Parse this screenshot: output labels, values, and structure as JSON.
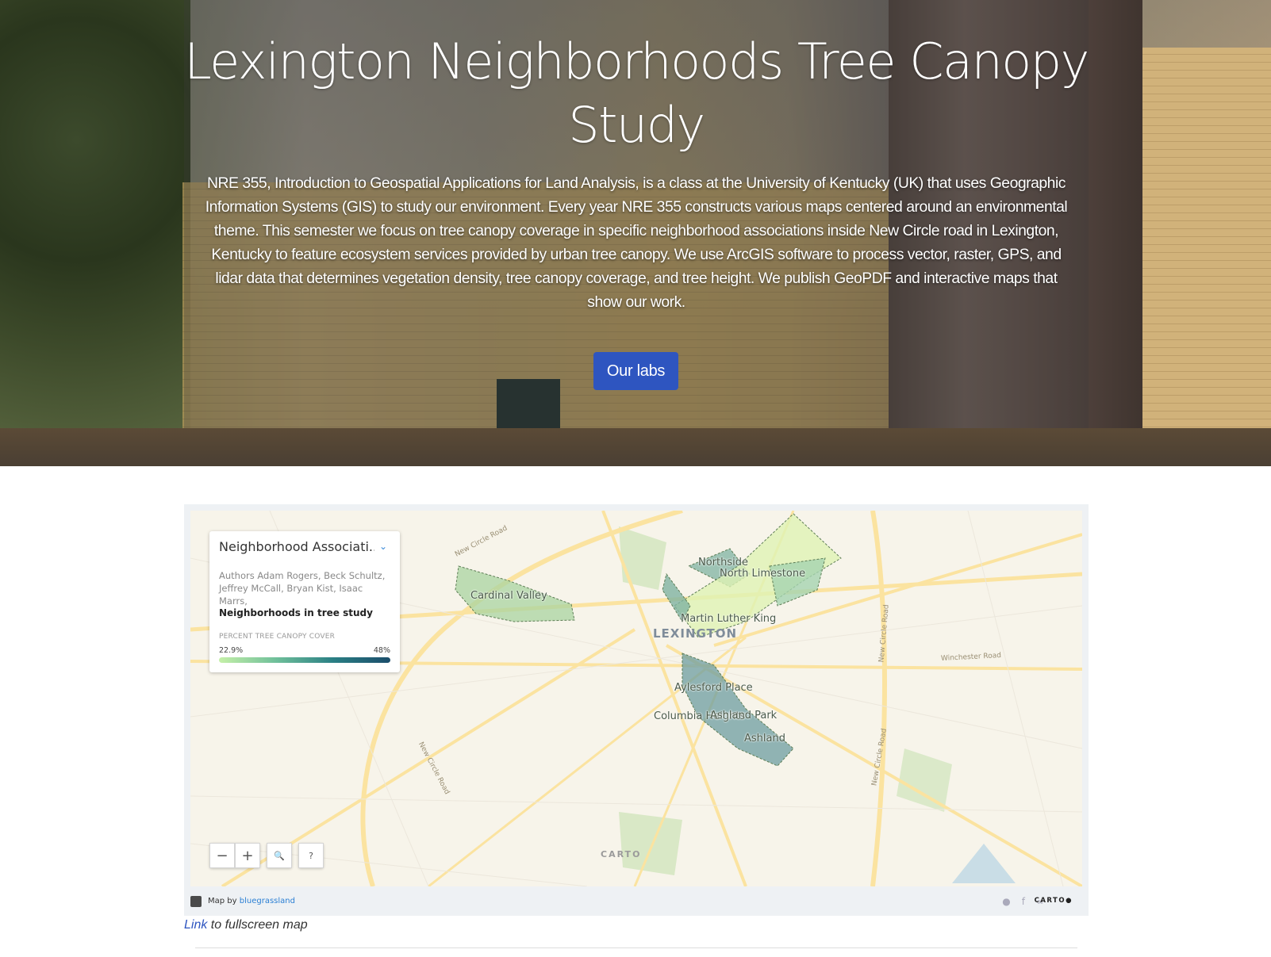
{
  "hero": {
    "title": "Lexington Neighborhoods Tree Canopy Study",
    "description": "NRE 355, Introduction to Geospatial Applications for Land Analysis, is a class at the University of Kentucky (UK) that uses Geographic Information Systems (GIS) to study our environment. Every year NRE 355 constructs various maps centered around an environmental theme. This semester we focus on tree canopy coverage in specific neighborhood associations inside New Circle road in Lexington, Kentucky to feature ecosystem services provided by urban tree canopy. We use ArcGIS software to process vector, raster, GPS, and lidar data that determines vegetation density, tree canopy coverage, and tree height. We publish GeoPDF and interactive maps that show our work.",
    "button_label": "Our labs",
    "button_color": "#2e55c0"
  },
  "map": {
    "legend": {
      "title": "Neighborhood Associati...",
      "authors": "Authors Adam Rogers, Beck Schultz, Jeffrey McCall, Bryan Kist, Isaac Marrs,",
      "layer_title": "Neighborhoods in tree study",
      "ramp_label": "PERCENT TREE CANOPY COVER",
      "min": "22.9%",
      "max": "48%",
      "ramp_colors": [
        "#c5f0a8",
        "#6fbf9a",
        "#2a7f84",
        "#1b4d6b"
      ]
    },
    "labels": {
      "city": "LEXINGTON",
      "cardinal_valley": "Cardinal Valley",
      "northside": "Northside",
      "north_limestone": "North Limestone",
      "martin_luther_king": "Martin Luther King",
      "aylesford_place": "Aylesford Place",
      "columbia_heights": "Columbia Heights",
      "ashland_park": "Ashland Park",
      "ashland": "Ashland",
      "road_new_circle_nw": "New Circle Road",
      "road_new_circle_sw": "New Circle Road",
      "road_new_circle_e1": "New Circle Road",
      "road_new_circle_e2": "New Circle Road",
      "road_winchester": "Winchester Road"
    },
    "controls": {
      "zoom_out": "−",
      "zoom_in": "+",
      "search": "🔍",
      "help": "?"
    },
    "watermark": "CARTO",
    "footer": {
      "by_prefix": "Map by",
      "by_user": "bluegrassland",
      "logo": "CARTO●"
    }
  },
  "caption": {
    "link_text": "Link",
    "rest": " to fullscreen map"
  }
}
